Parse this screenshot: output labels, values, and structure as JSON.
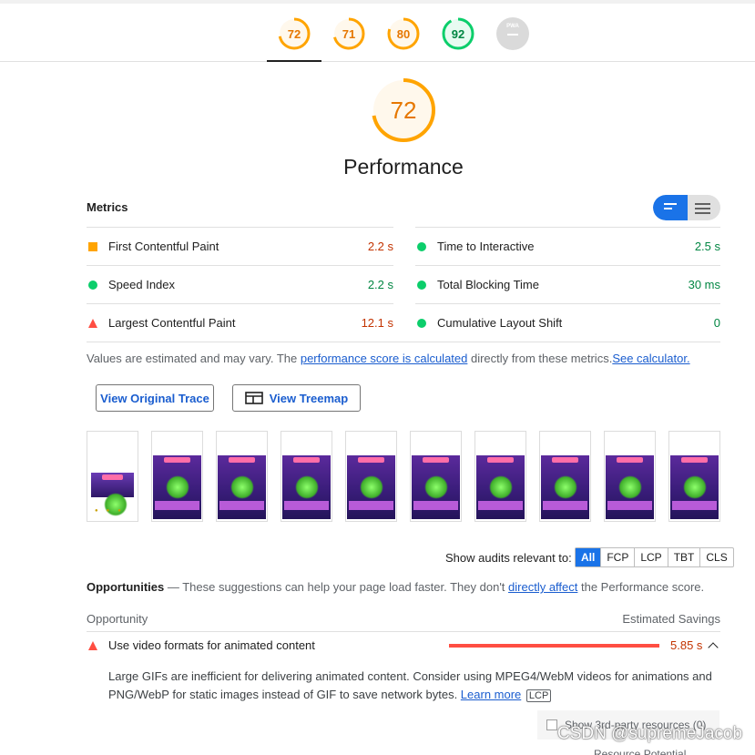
{
  "top_scores": [
    {
      "value": "72",
      "color": "#ffa400",
      "fill": 0.72
    },
    {
      "value": "71",
      "color": "#ffa400",
      "fill": 0.71
    },
    {
      "value": "80",
      "color": "#ffa400",
      "fill": 0.8
    },
    {
      "value": "92",
      "color": "#0cce6b",
      "fill": 0.92
    },
    {
      "value": "PWA",
      "color": "#bdbdbd",
      "fill": 1.0
    }
  ],
  "main_score": {
    "value": "72",
    "fill": 0.72,
    "color": "#ffa400"
  },
  "category_title": "Performance",
  "metrics": {
    "title": "Metrics",
    "left": [
      {
        "label": "First Contentful Paint",
        "value": "2.2 s",
        "indicator": "square",
        "status": "average"
      },
      {
        "label": "Speed Index",
        "value": "2.2 s",
        "indicator": "circle",
        "status": "pass"
      },
      {
        "label": "Largest Contentful Paint",
        "value": "12.1 s",
        "indicator": "triangle",
        "status": "fail"
      }
    ],
    "right": [
      {
        "label": "Time to Interactive",
        "value": "2.5 s",
        "indicator": "circle",
        "status": "pass"
      },
      {
        "label": "Total Blocking Time",
        "value": "30 ms",
        "indicator": "circle",
        "status": "pass"
      },
      {
        "label": "Cumulative Layout Shift",
        "value": "0",
        "indicator": "circle",
        "status": "pass"
      }
    ]
  },
  "note": {
    "prefix": "Values are estimated and may vary. The ",
    "link1": "performance score is calculated",
    "middle": " directly from these metrics.",
    "link2": "See calculator."
  },
  "buttons": {
    "trace": "View Original Trace",
    "treemap": "View Treemap"
  },
  "filmstrip_count": 10,
  "filter": {
    "label": "Show audits relevant to:",
    "options": [
      "All",
      "FCP",
      "LCP",
      "TBT",
      "CLS"
    ],
    "active": "All"
  },
  "opportunities": {
    "title": "Opportunities",
    "desc_prefix": " — These suggestions can help your page load faster. They don't ",
    "desc_link": "directly affect",
    "desc_suffix": " the Performance score.",
    "col_left": "Opportunity",
    "col_right": "Estimated Savings",
    "items": [
      {
        "title": "Use video formats for animated content",
        "savings": "5.85 s",
        "description": "Large GIFs are inefficient for delivering animated content. Consider using MPEG4/WebM videos for animations and PNG/WebP for static images instead of GIF to save network bytes. ",
        "learn_more": "Learn more",
        "tag": "LCP"
      }
    ]
  },
  "third_party": "Show 3rd-party resources (0)",
  "partial_text": "Resource   Potential",
  "watermark": "CSDN @supremeJacob"
}
